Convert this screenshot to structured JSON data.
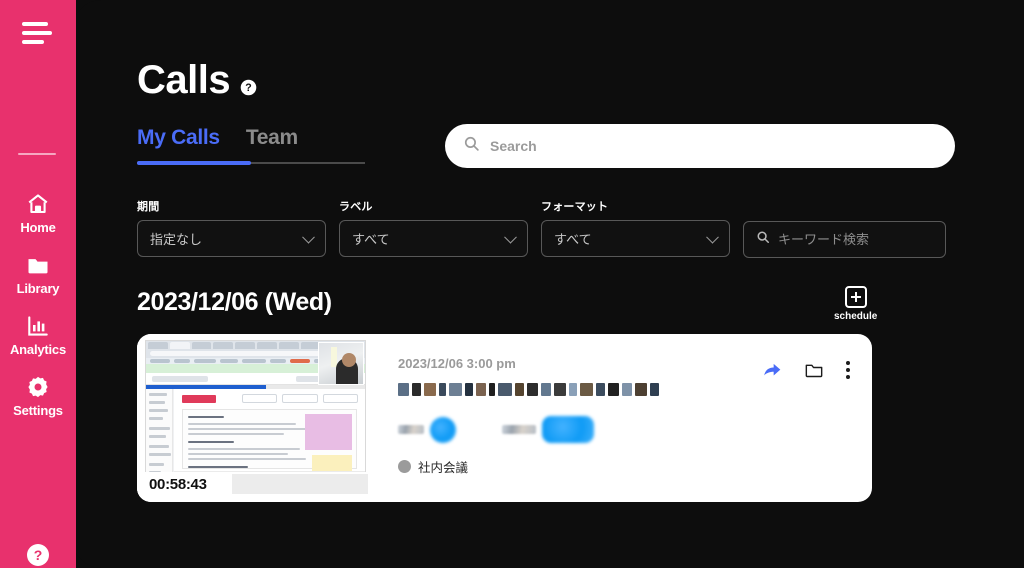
{
  "theme": {
    "sidebar_color": "#e8316d",
    "background_color": "#0d0d0d",
    "accent_blue": "#4a6cf7",
    "card_background": "#ffffff"
  },
  "sidebar": {
    "menu_icon": "hamburger-icon",
    "items": [
      {
        "label": "Home",
        "icon": "home-icon"
      },
      {
        "label": "Library",
        "icon": "folder-icon"
      },
      {
        "label": "Analytics",
        "icon": "bar-chart-icon"
      },
      {
        "label": "Settings",
        "icon": "gear-icon"
      }
    ],
    "help_icon": "question-circle-icon"
  },
  "header": {
    "title": "Calls",
    "help_icon": "question-circle-icon"
  },
  "tabs": [
    {
      "label": "My Calls",
      "active": true
    },
    {
      "label": "Team",
      "active": false
    }
  ],
  "search": {
    "placeholder": "Search",
    "value": "",
    "icon": "search-icon"
  },
  "filters": [
    {
      "label": "期間",
      "value": "指定なし",
      "icon": "chevron-down-icon"
    },
    {
      "label": "ラベル",
      "value": "すべて",
      "icon": "chevron-down-icon"
    },
    {
      "label": "フォーマット",
      "value": "すべて",
      "icon": "chevron-down-icon"
    }
  ],
  "keyword_search": {
    "placeholder": "キーワード検索",
    "value": "",
    "icon": "search-icon"
  },
  "date_group": {
    "heading": "2023/12/06 (Wed)",
    "schedule_button": {
      "label": "schedule",
      "icon": "plus-square-icon"
    }
  },
  "call": {
    "duration": "00:58:43",
    "timestamp": "2023/12/06 3:00 pm",
    "title_redacted": true,
    "tag": {
      "label": "社内会議",
      "dot_color": "#9b9b9b"
    },
    "participants_redacted": true,
    "actions": [
      {
        "name": "share",
        "icon": "share-arrow-icon"
      },
      {
        "name": "move-to-folder",
        "icon": "folder-icon"
      },
      {
        "name": "more-options",
        "icon": "kebab-menu-icon"
      }
    ]
  }
}
